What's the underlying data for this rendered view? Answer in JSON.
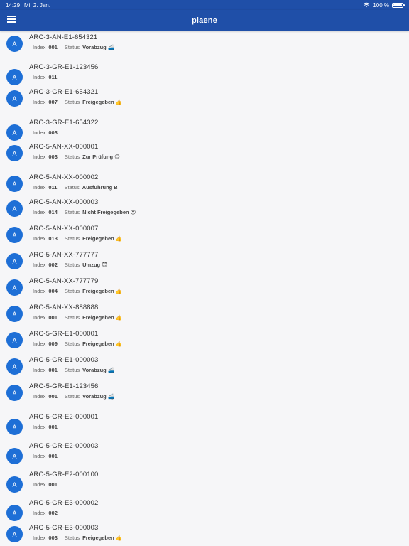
{
  "statusbar": {
    "time": "14:29",
    "date": "Mi. 2. Jan.",
    "battery": "100 %",
    "battery_level": 1.0
  },
  "appbar": {
    "title": "plaene"
  },
  "labels": {
    "index": "Index",
    "status": "Status"
  },
  "items": [
    {
      "avatar": "A",
      "title": "ARC-3-AN-E1-654321",
      "index": "001",
      "status": "Vorabzug 🚄"
    },
    {
      "avatar": "A",
      "title": "ARC-3-GR-E1-123456",
      "index": "011",
      "status": null
    },
    {
      "avatar": "A",
      "title": "ARC-3-GR-E1-654321",
      "index": "007",
      "status": "Freigegeben 👍"
    },
    {
      "avatar": "A",
      "title": "ARC-3-GR-E1-654322",
      "index": "003",
      "status": null
    },
    {
      "avatar": "A",
      "title": "ARC-5-AN-XX-000001",
      "index": "003",
      "status": "Zur Prüfung 😊"
    },
    {
      "avatar": "A",
      "title": "ARC-5-AN-XX-000002",
      "index": "011",
      "status": "Ausführung B"
    },
    {
      "avatar": "A",
      "title": "ARC-5-AN-XX-000003",
      "index": "014",
      "status": "Nicht Freigegeben 😡"
    },
    {
      "avatar": "A",
      "title": "ARC-5-AN-XX-000007",
      "index": "013",
      "status": "Freigegeben 👍"
    },
    {
      "avatar": "A",
      "title": "ARC-5-AN-XX-777777",
      "index": "002",
      "status": "Umzug 😈"
    },
    {
      "avatar": "A",
      "title": "ARC-5-AN-XX-777779",
      "index": "004",
      "status": "Freigegeben 👍"
    },
    {
      "avatar": "A",
      "title": "ARC-5-AN-XX-888888",
      "index": "001",
      "status": "Freigegeben 👍"
    },
    {
      "avatar": "A",
      "title": "ARC-5-GR-E1-000001",
      "index": "009",
      "status": "Freigegeben 👍"
    },
    {
      "avatar": "A",
      "title": "ARC-5-GR-E1-000003",
      "index": "001",
      "status": "Vorabzug 🚄"
    },
    {
      "avatar": "A",
      "title": "ARC-5-GR-E1-123456",
      "index": "001",
      "status": "Vorabzug 🚄"
    },
    {
      "avatar": "A",
      "title": "ARC-5-GR-E2-000001",
      "index": "001",
      "status": null
    },
    {
      "avatar": "A",
      "title": "ARC-5-GR-E2-000003",
      "index": "001",
      "status": null
    },
    {
      "avatar": "A",
      "title": "ARC-5-GR-E2-000100",
      "index": "001",
      "status": null
    },
    {
      "avatar": "A",
      "title": "ARC-5-GR-E3-000002",
      "index": "002",
      "status": null
    },
    {
      "avatar": "A",
      "title": "ARC-5-GR-E3-000003",
      "index": "003",
      "status": "Freigegeben 👍"
    }
  ]
}
